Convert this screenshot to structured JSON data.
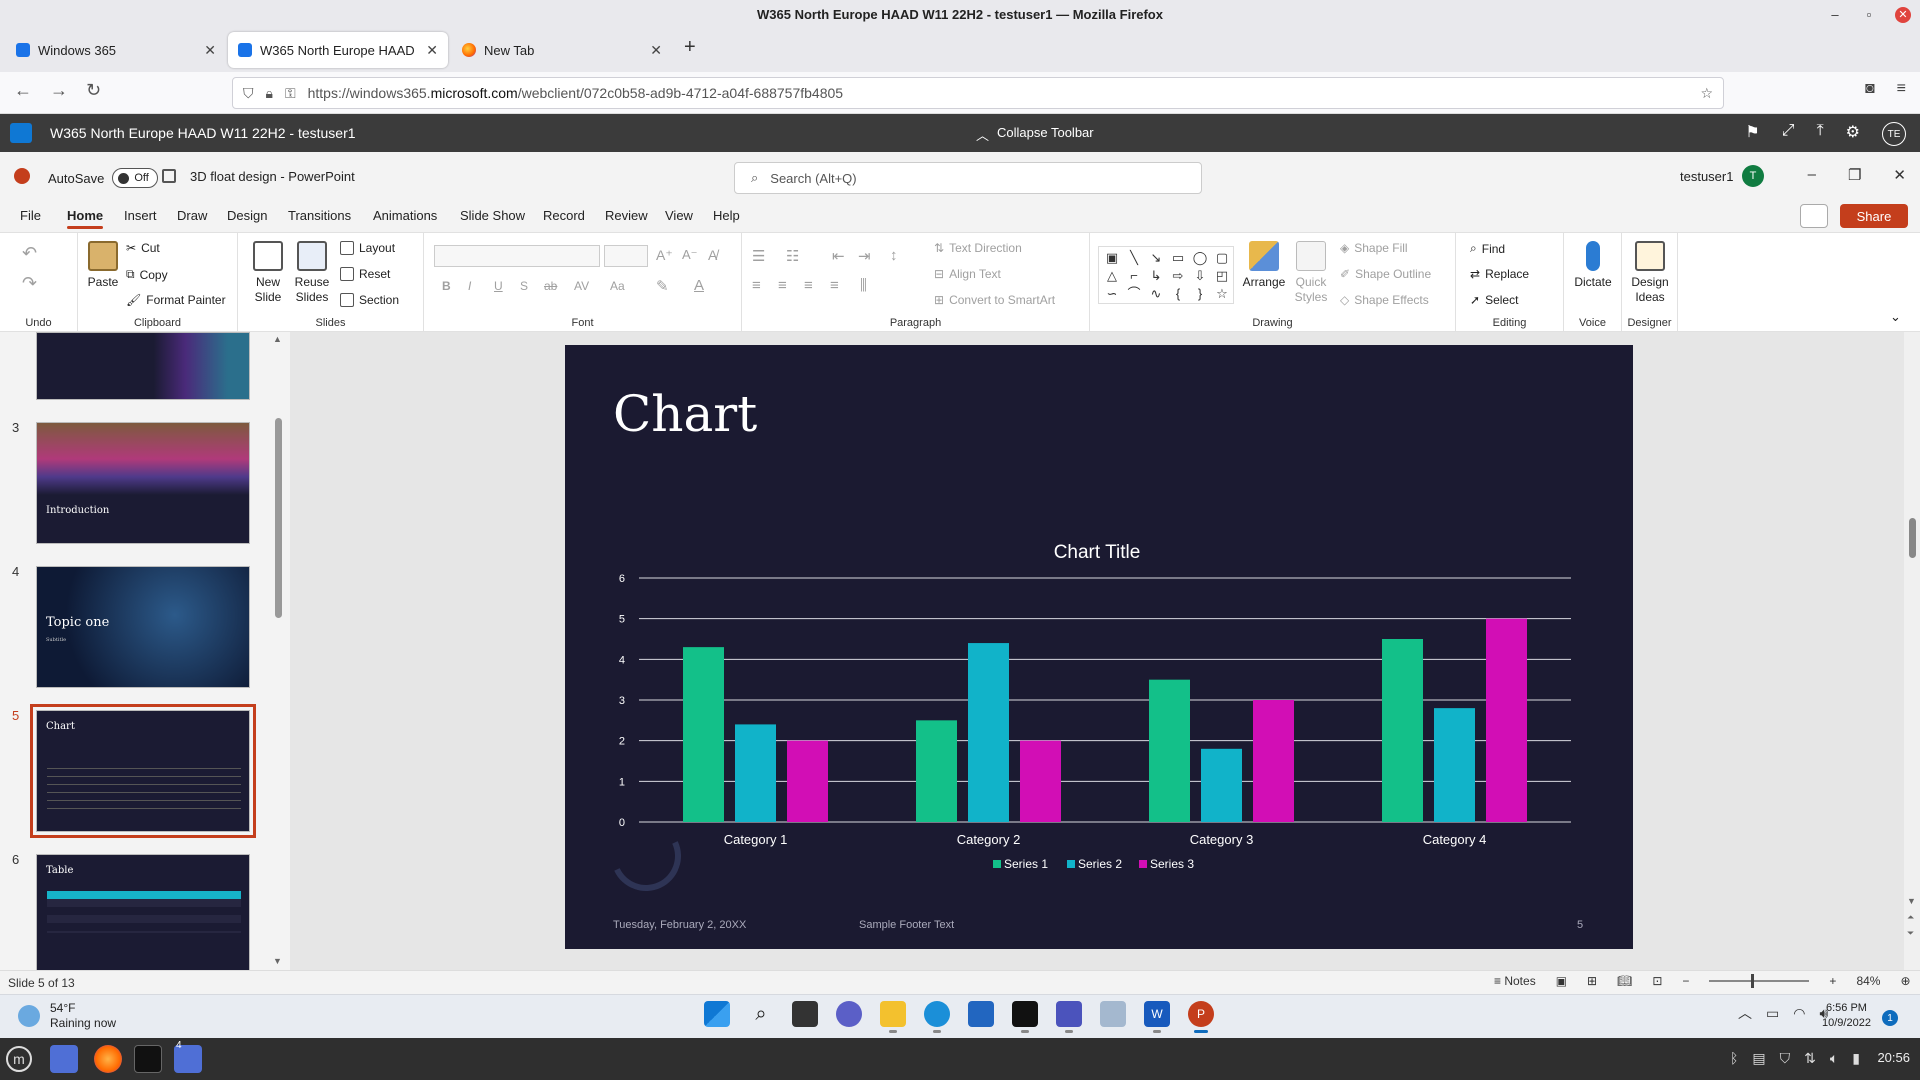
{
  "firefox": {
    "window_title": "W365 North Europe HAAD W11 22H2 - testuser1 — Mozilla Firefox",
    "tabs": [
      {
        "label": "Windows 365",
        "close": "✕"
      },
      {
        "label": "W365 North Europe HAAD W11 22H2 - testuser1",
        "close": "✕"
      },
      {
        "label": "New Tab",
        "close": "✕"
      }
    ],
    "new_tab": "+",
    "url_prefix": "https://windows365.",
    "url_domain": "microsoft.com",
    "url_path": "/webclient/072c0b58-ad9b-4712-a04f-688757fb4805"
  },
  "w365": {
    "title": "W365 North Europe HAAD W11 22H2 - testuser1",
    "collapse": "Collapse Toolbar",
    "user_initials": "TE"
  },
  "ppt": {
    "autosave_label": "AutoSave",
    "autosave_state": "Off",
    "doc_name": "3D float design  -  PowerPoint",
    "search_placeholder": "Search (Alt+Q)",
    "user": "testuser1",
    "user_initial": "T",
    "menu_tabs": [
      "File",
      "Home",
      "Insert",
      "Draw",
      "Design",
      "Transitions",
      "Animations",
      "Slide Show",
      "Record",
      "Review",
      "View",
      "Help"
    ],
    "share": "Share"
  },
  "ribbon": {
    "groups": {
      "undo": "Undo",
      "clipboard": "Clipboard",
      "slides": "Slides",
      "font": "Font",
      "paragraph": "Paragraph",
      "drawing": "Drawing",
      "editing": "Editing",
      "voice": "Voice",
      "designer": "Designer"
    },
    "paste": "Paste",
    "cut": "Cut",
    "copy": "Copy",
    "format_painter": "Format Painter",
    "new_slide_1": "New",
    "new_slide_2": "Slide",
    "reuse_1": "Reuse",
    "reuse_2": "Slides",
    "layout": "Layout",
    "reset": "Reset",
    "section": "Section",
    "text_direction": "Text Direction",
    "align_text": "Align Text",
    "convert_smartart": "Convert to SmartArt",
    "arrange": "Arrange",
    "quick_styles_1": "Quick",
    "quick_styles_2": "Styles",
    "shape_fill": "Shape Fill",
    "shape_outline": "Shape Outline",
    "shape_effects": "Shape Effects",
    "find": "Find",
    "replace": "Replace",
    "select": "Select",
    "dictate": "Dictate",
    "design_ideas_1": "Design",
    "design_ideas_2": "Ideas",
    "font_buttons": [
      "B",
      "I",
      "U",
      "S",
      "ab"
    ]
  },
  "thumbnails": [
    {
      "num": "3",
      "title": "Introduction"
    },
    {
      "num": "4",
      "title": "Topic one",
      "subtitle": "Subtitle"
    },
    {
      "num": "5",
      "title": "Chart"
    },
    {
      "num": "6",
      "title": "Table"
    }
  ],
  "slide": {
    "title": "Chart",
    "date": "Tuesday, February 2, 20XX",
    "footer": "Sample Footer Text",
    "number": "5"
  },
  "chart_data": {
    "type": "bar",
    "title": "Chart Title",
    "categories": [
      "Category 1",
      "Category 2",
      "Category 3",
      "Category 4"
    ],
    "series": [
      {
        "name": "Series 1",
        "values": [
          4.3,
          2.5,
          3.5,
          4.5
        ],
        "color": "#13c089"
      },
      {
        "name": "Series 2",
        "values": [
          2.4,
          4.4,
          1.8,
          2.8
        ],
        "color": "#11b3c9"
      },
      {
        "name": "Series 3",
        "values": [
          2,
          2,
          3,
          5
        ],
        "color": "#d20eb5"
      }
    ],
    "ylim": [
      0,
      6
    ],
    "yticks": [
      0,
      1,
      2,
      3,
      4,
      5,
      6
    ],
    "grid": true,
    "legend": "bottom"
  },
  "status": {
    "slide_info": "Slide 5 of 13",
    "notes": "Notes",
    "zoom": "84%"
  },
  "taskbar": {
    "temp": "54°F",
    "weather": "Raining now",
    "time": "6:56 PM",
    "date": "10/9/2022",
    "badge": "1"
  },
  "linux_panel": {
    "time": "20:56",
    "badge": "4"
  },
  "colors": {
    "accent": "#c43e1c",
    "slide_bg": "#1b1a31"
  }
}
